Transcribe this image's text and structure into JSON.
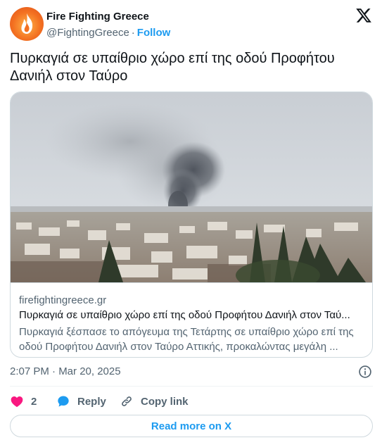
{
  "author": {
    "name": "Fire Fighting Greece",
    "handle": "@FightingGreece",
    "separator": "·",
    "follow_label": "Follow"
  },
  "tweet": {
    "text": "Πυρκαγιά σε υπαίθριο χώρο επί της οδού Προφήτου Δανιήλ στον Ταύρο",
    "timestamp": "2:07 PM · Mar 20, 2025"
  },
  "card": {
    "domain": "firefightingreece.gr",
    "title": "Πυρκαγιά σε υπαίθριο χώρο επί της οδού Προφήτου Δανιήλ στον Ταύ...",
    "description": "Πυρκαγιά ξέσπασε το απόγευμα της Τετάρτης σε υπαίθριο χώρο επί της οδού Προφήτου Δανιήλ στον Ταύρο Αττικής, προκαλώντας μεγάλη ..."
  },
  "actions": {
    "like_count": "2",
    "reply_label": "Reply",
    "copy_label": "Copy link"
  },
  "footer": {
    "read_more_label": "Read more on X"
  },
  "colors": {
    "accent": "#1d9bf0",
    "like": "#f91880",
    "text": "#0f1419",
    "muted": "#536471",
    "border": "#cfd9de"
  },
  "icons": {
    "brand": "x-logo-icon",
    "info": "info-icon",
    "like": "heart-icon",
    "reply": "speech-bubble-icon",
    "copy": "link-icon"
  }
}
